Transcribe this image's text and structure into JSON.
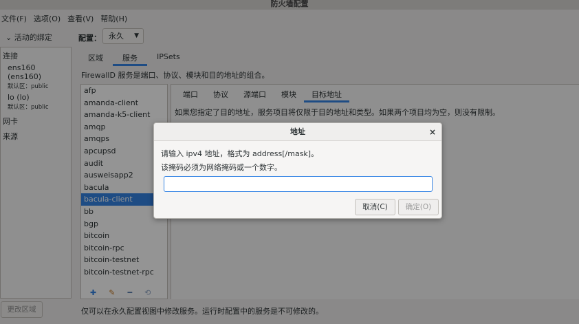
{
  "window": {
    "title": "防火墙配置"
  },
  "menu": [
    "文件(F)",
    "选项(O)",
    "查看(V)",
    "帮助(H)"
  ],
  "sidebar": {
    "toggle_label": "活动的绑定",
    "toggle_icon": "chevron-down-icon",
    "connection_heading": "连接",
    "connections": [
      {
        "name": "ens160 (ens160)",
        "zone": "默认区：public"
      },
      {
        "name": "lo (lo)",
        "zone": "默认区：public"
      }
    ],
    "nic_heading": "网卡",
    "source_heading": "来源",
    "change_zone_button": "更改区域"
  },
  "config": {
    "label": "配置：",
    "value": "永久"
  },
  "tabs": [
    "区域",
    "服务",
    "IPSets"
  ],
  "active_tab": "服务",
  "services_description": "FirewallD 服务是端口、协议、模块和目的地址的组合。",
  "services": [
    "afp",
    "amanda-client",
    "amanda-k5-client",
    "amqp",
    "amqps",
    "apcupsd",
    "audit",
    "ausweisapp2",
    "bacula",
    "bacula-client",
    "bb",
    "bgp",
    "bitcoin",
    "bitcoin-rpc",
    "bitcoin-testnet",
    "bitcoin-testnet-rpc"
  ],
  "selected_service": "bacula-client",
  "subtabs": [
    "端口",
    "协议",
    "源端口",
    "模块",
    "目标地址"
  ],
  "active_subtab": "目标地址",
  "subtab_description": "如果您指定了目的地址，服务项目将仅限于目的地址和类型。如果两个项目均为空，则没有限制。",
  "status_text": "仅可以在永久配置视图中修改服务。运行时配置中的服务是不可修改的。",
  "dialog": {
    "title": "地址",
    "line1": "请输入 ipv4 地址，格式为 address[/mask]。",
    "line2": "该掩码必须为网络掩码或一个数字。",
    "input_value": "",
    "cancel_label": "取消(C)",
    "ok_label": "确定(O)"
  },
  "colors": {
    "accent": "#3584e4"
  }
}
